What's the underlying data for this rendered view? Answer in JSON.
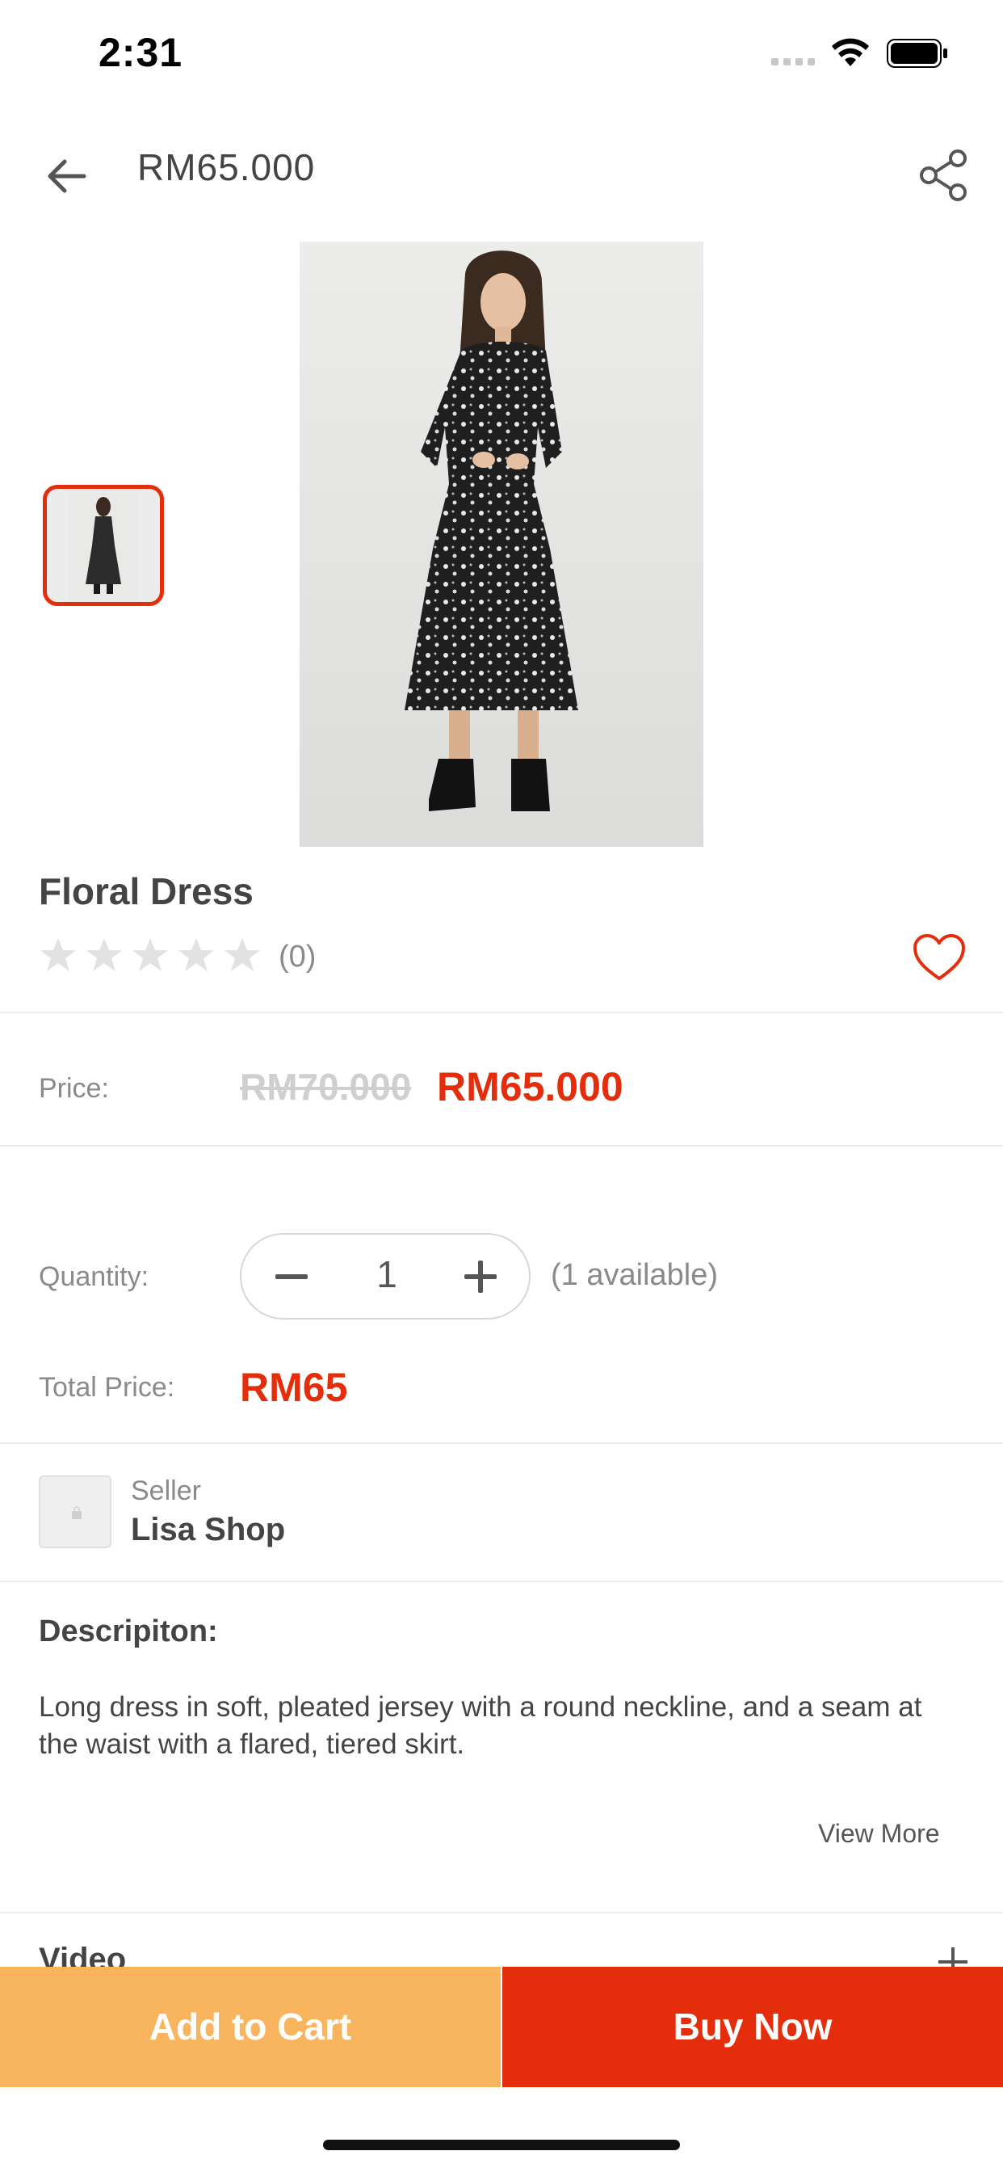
{
  "status_bar": {
    "time": "2:31"
  },
  "header": {
    "title": "RM65.000",
    "back_icon": "arrow-left-icon",
    "share_icon": "share-icon"
  },
  "gallery": {
    "selected_index": 0,
    "thumbnail_border_color": "#e32d0b"
  },
  "product": {
    "name": "Floral Dress",
    "rating_stars": 5,
    "rating_filled": 0,
    "rating_count": "(0)",
    "favorite_icon": "heart-outline-icon"
  },
  "price": {
    "label": "Price:",
    "original": "RM70.000",
    "current": "RM65.000"
  },
  "quantity": {
    "label": "Quantity:",
    "value": "1",
    "available": "(1 available)"
  },
  "total": {
    "label": "Total Price:",
    "value": "RM65"
  },
  "seller": {
    "label": "Seller",
    "name": "Lisa Shop"
  },
  "description": {
    "title": "Descripiton:",
    "text": "Long dress in soft, pleated jersey with a round neckline, and a seam at the waist with a flared, tiered skirt.",
    "view_more": "View More"
  },
  "video": {
    "label": "Video"
  },
  "actions": {
    "add_to_cart": "Add to Cart",
    "buy_now": "Buy Now"
  },
  "colors": {
    "accent": "#e32d0b",
    "cart_button": "#f8b55d",
    "muted_text": "#8a8a8a"
  }
}
